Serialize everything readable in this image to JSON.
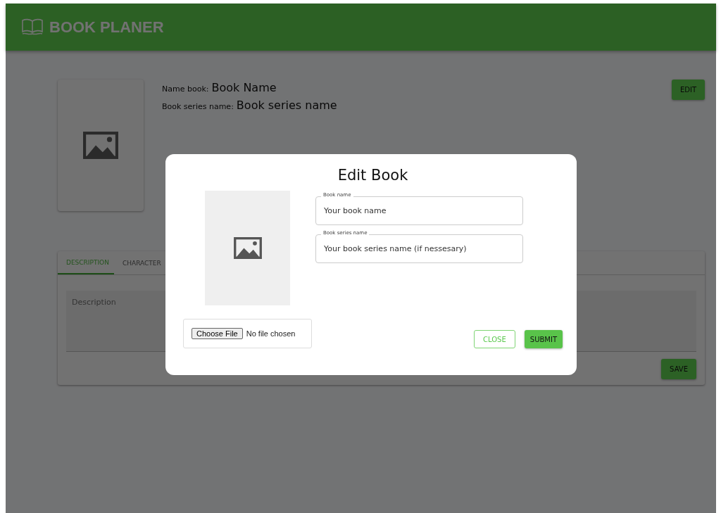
{
  "header": {
    "title": "BOOK PLANER"
  },
  "book": {
    "name_label": "Name book:",
    "name": "Book Name",
    "series_label": "Book series name:",
    "series_name": "Book series name",
    "edit_button": "EDIT"
  },
  "tabs": [
    {
      "label": "DESCRIPTION",
      "selected": true
    },
    {
      "label": "CHARACTER",
      "selected": false
    }
  ],
  "description": {
    "placeholder": "Description",
    "save_button": "SAVE"
  },
  "modal": {
    "title": "Edit Book",
    "fields": [
      {
        "label": "Book name",
        "placeholder": "Your book name"
      },
      {
        "label": "Book series name",
        "placeholder": "Your book series name (if nessesary)"
      }
    ],
    "file": {
      "button": "Choose File",
      "status": "No file chosen"
    },
    "close_button": "CLOSE",
    "submit_button": "SUBMIT"
  }
}
